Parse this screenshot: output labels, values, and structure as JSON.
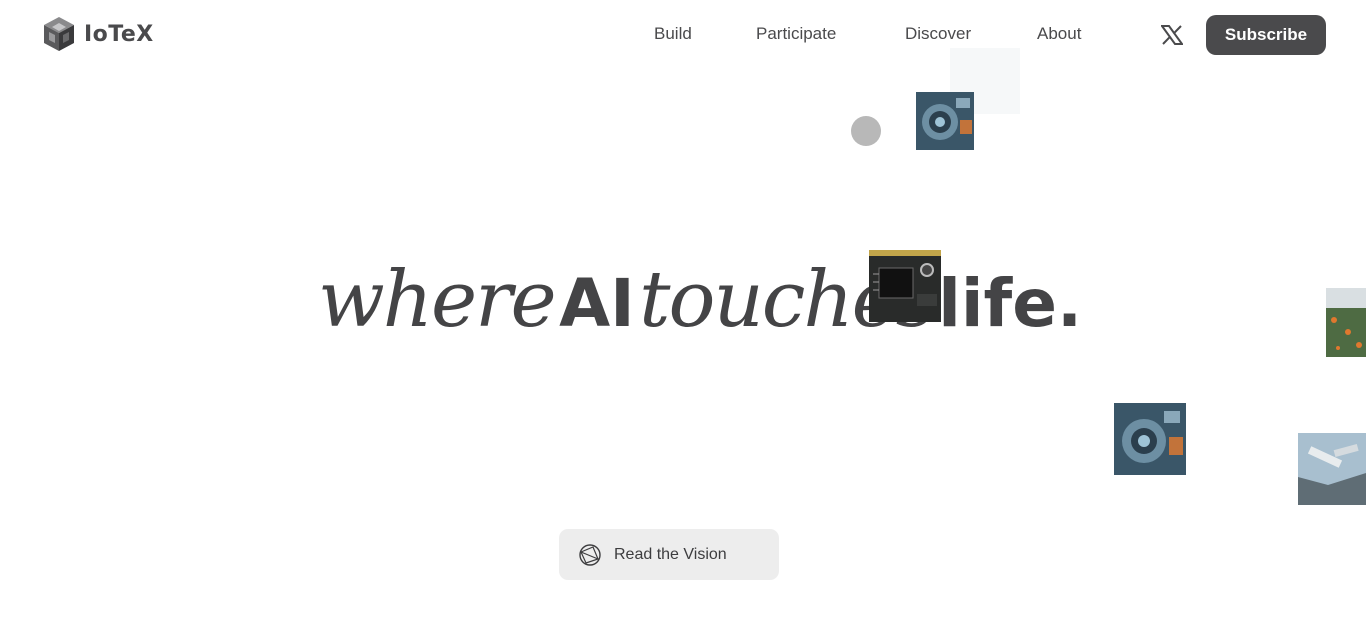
{
  "header": {
    "brand": "IoTeX",
    "nav": [
      "Build",
      "Participate",
      "Discover",
      "About"
    ],
    "subscribe_label": "Subscribe"
  },
  "hero": {
    "word1": "where",
    "word2": "AI",
    "word3": "touches",
    "word4": "life."
  },
  "cta": {
    "read_vision_label": "Read the Vision"
  },
  "icons": {
    "logo": "iotex-cube-logo",
    "social": "x-logo-icon",
    "cta": "globe-icon"
  }
}
